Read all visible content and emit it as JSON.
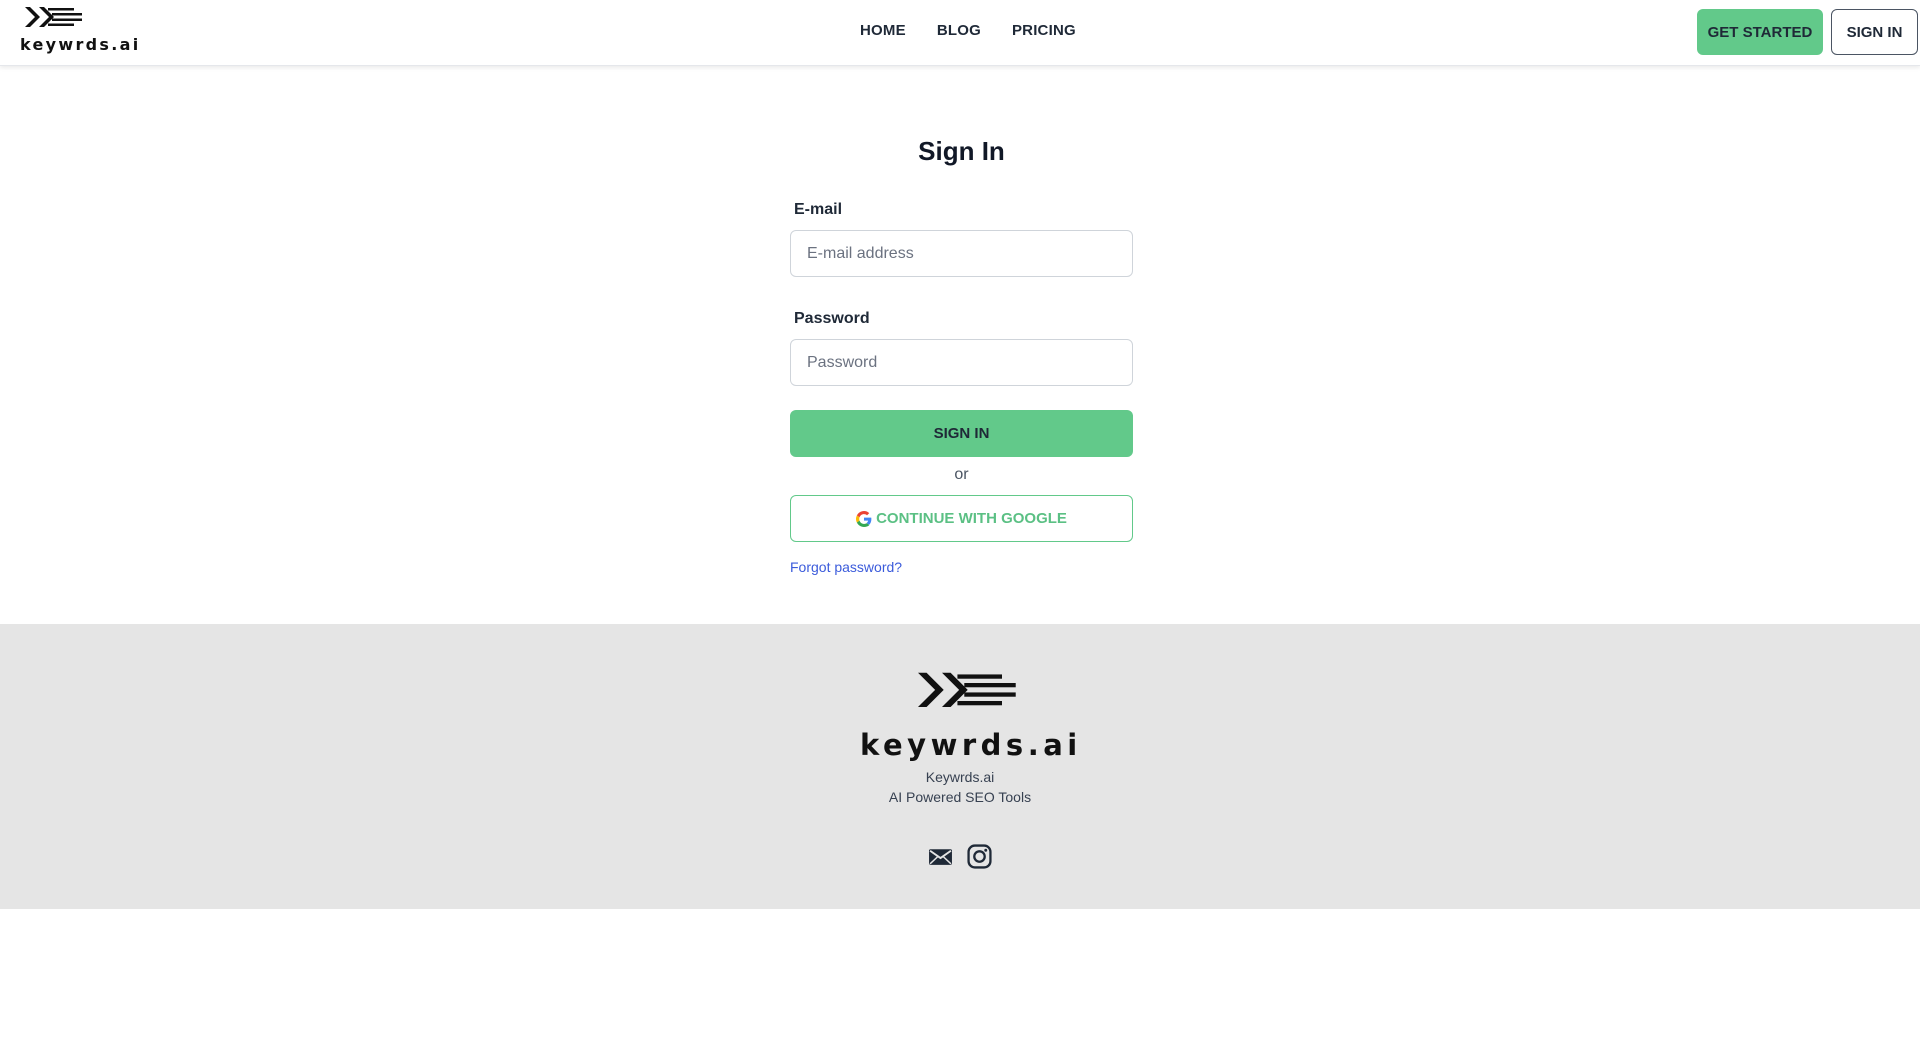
{
  "header": {
    "logo_text": "keywrds.ai",
    "nav": [
      {
        "label": "HOME"
      },
      {
        "label": "BLOG"
      },
      {
        "label": "PRICING"
      }
    ],
    "get_started_label": "GET STARTED",
    "sign_in_label": "SIGN IN"
  },
  "form": {
    "title": "Sign In",
    "email_label": "E-mail",
    "email_placeholder": "E-mail address",
    "email_value": "",
    "password_label": "Password",
    "password_placeholder": "Password",
    "password_value": "",
    "submit_label": "SIGN IN",
    "or_text": "or",
    "google_label": "CONTINUE WITH GOOGLE",
    "forgot_label": "Forgot password?"
  },
  "footer": {
    "logo_text": "keywrds.ai",
    "company_name": "Keywrds.ai",
    "tagline": "AI Powered SEO Tools",
    "social": [
      {
        "icon": "email-icon"
      },
      {
        "icon": "instagram-icon"
      }
    ]
  },
  "colors": {
    "accent": "#62c98a",
    "footer_bg": "#e5e5e5",
    "link": "#3b5bdb"
  }
}
